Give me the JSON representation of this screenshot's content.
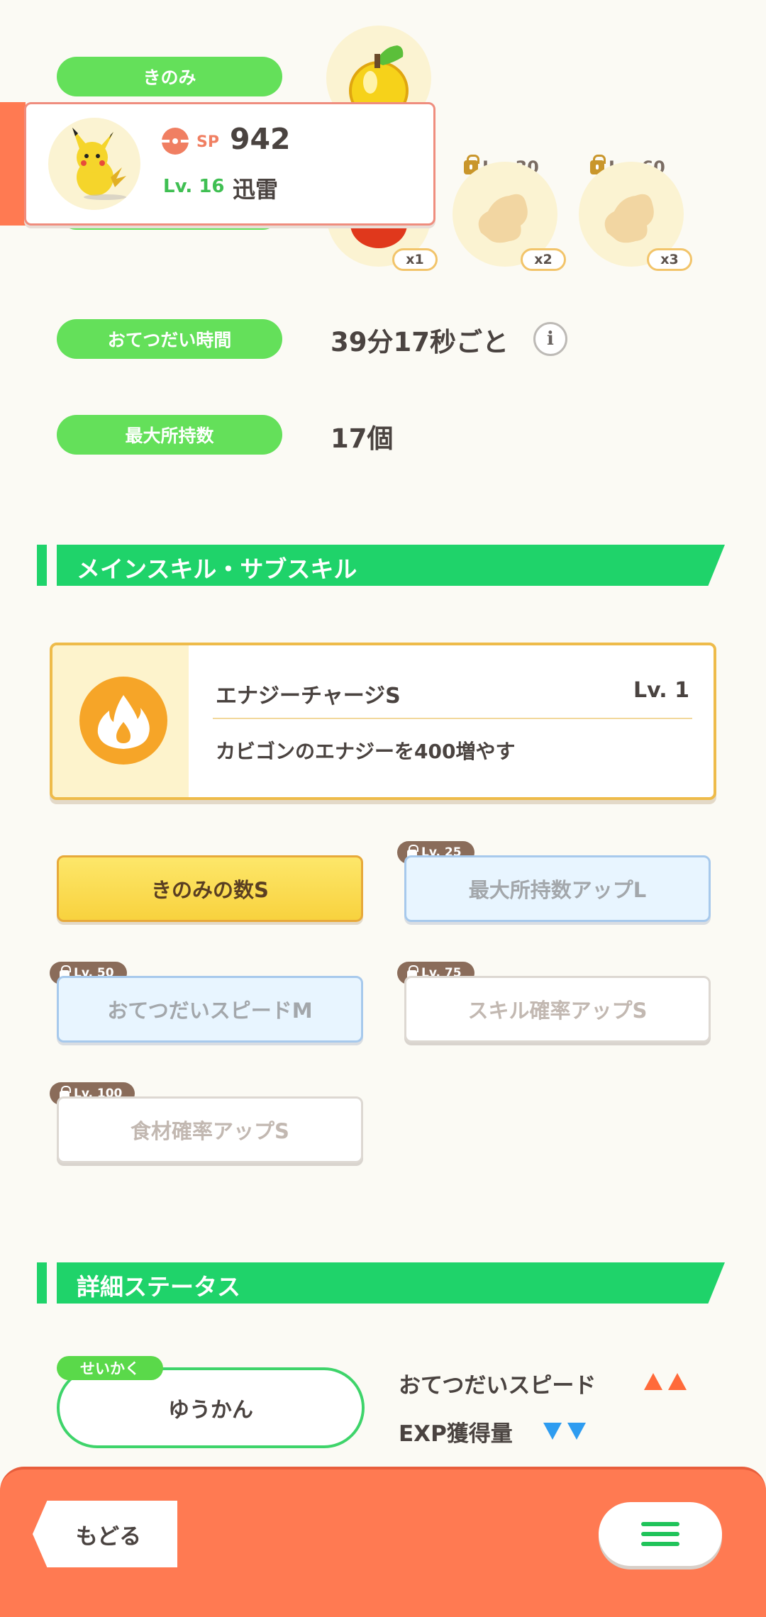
{
  "ingredients_label": "きのみ",
  "pokemon_card": {
    "sp_icon": "pokeball-icon",
    "sp_label": "SP",
    "sp_value": "942",
    "level": "Lv. 16",
    "name": "迅雷"
  },
  "ingredients": [
    {
      "count": "x1",
      "lock": "",
      "name": "fruit"
    },
    {
      "count": "x2",
      "lock": "Lv. 30",
      "name": "ginger-icon"
    },
    {
      "count": "x3",
      "lock": "Lv. 60",
      "name": "ginger-icon"
    }
  ],
  "help_time": {
    "label": "おてつだい時間",
    "value": "39分17秒ごと"
  },
  "max_carry": {
    "label": "最大所持数",
    "value": "17個"
  },
  "skills_section": {
    "title": "メインスキル・サブスキル"
  },
  "main_skill": {
    "icon": "flame-icon",
    "name": "エナジーチャージS",
    "level": "Lv. 1",
    "description": "カビゴンのエナジーを400増やす"
  },
  "subskills": [
    {
      "label": "きのみの数S",
      "lock": ""
    },
    {
      "label": "最大所持数アップL",
      "lock": "Lv. 25"
    },
    {
      "label": "おてつだいスピードM",
      "lock": "Lv. 50"
    },
    {
      "label": "スキル確率アップS",
      "lock": "Lv. 75"
    },
    {
      "label": "食材確率アップS",
      "lock": "Lv. 100"
    }
  ],
  "detail_section": {
    "title": "詳細ステータス"
  },
  "nature": {
    "tag": "せいかく",
    "value": "ゆうかん",
    "up_label": "おてつだいスピード",
    "down_label": "EXP獲得量"
  },
  "footer": {
    "back_label": "もどる",
    "menu_icon": "hamburger-menu-icon"
  },
  "colors": {
    "accent_green": "#1fd36a",
    "pill_green": "#64e05a",
    "footer_orange": "#ff7a52",
    "gold": "#f8d23e"
  }
}
